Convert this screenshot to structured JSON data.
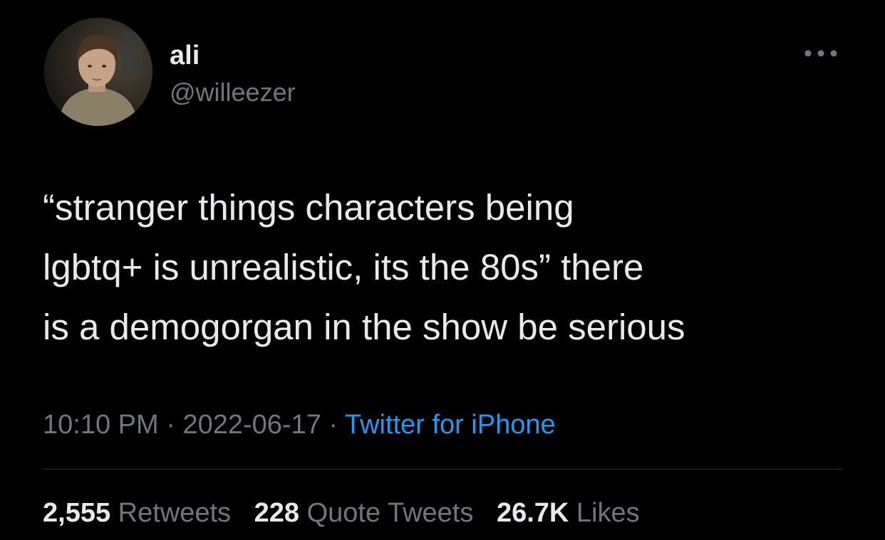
{
  "user": {
    "display_name": "ali",
    "handle": "@willeezer",
    "avatar_icon": "profile-photo"
  },
  "more_icon": "ellipsis-icon",
  "tweet": {
    "text": "“stranger things characters being\nlgbtq+ is unrealistic, its the 80s” there\nis a demogorgan in the show be serious",
    "time": "10:10 PM",
    "separator": " · ",
    "date": "2022-06-17",
    "source": "Twitter for iPhone"
  },
  "stats": {
    "retweets_count": "2,555",
    "retweets_label": "Retweets",
    "quotes_count": "228",
    "quotes_label": "Quote Tweets",
    "likes_count": "26.7K",
    "likes_label": "Likes"
  },
  "colors": {
    "background": "#000000",
    "primary_text": "#e7e9ea",
    "secondary_text": "#71767b",
    "link": "#1d9bf0",
    "divider": "#2f3336"
  }
}
